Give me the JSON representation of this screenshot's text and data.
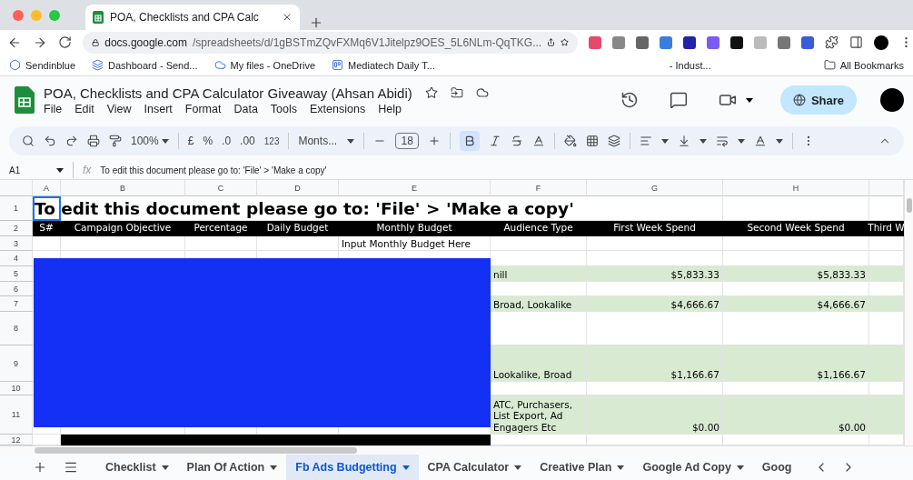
{
  "browser": {
    "tab_title": "POA, Checklists and CPA Calc",
    "url_host": "docs.google.com",
    "url_path": "/spreadsheets/d/1gBSTmZQvFXMq6V1Jitelpz9OES_5L6NLm-QqTKG...",
    "bookmarks": [
      "Sendinblue",
      "Dashboard - Send...",
      "My files - OneDrive",
      "Mediatech Daily T...",
      "- Indust..."
    ],
    "all_bookmarks": "All Bookmarks"
  },
  "doc": {
    "title": "POA, Checklists and CPA Calculator Giveaway (Ahsan Abidi)",
    "menu": [
      "File",
      "Edit",
      "View",
      "Insert",
      "Format",
      "Data",
      "Tools",
      "Extensions",
      "Help"
    ],
    "share": "Share"
  },
  "toolbar": {
    "zoom": "100%",
    "currency": "£",
    "percent": "%",
    "dec_less": ".0",
    "dec_more": ".00",
    "number_format": "123",
    "font": "Monts...",
    "font_size": "18",
    "bold_on": true
  },
  "formula_bar": {
    "cell": "A1",
    "fx": "fx",
    "value": "To edit this document please go to: 'File' > 'Make a copy'"
  },
  "columns": [
    "A",
    "B",
    "C",
    "D",
    "E",
    "F",
    "G",
    "H"
  ],
  "rows": [
    {
      "number": "1",
      "kind": "title",
      "title": "To edit this document please go to: 'File' > 'Make a copy'"
    },
    {
      "number": "2",
      "kind": "header",
      "headers": [
        "S#",
        "Campaign Objective",
        "Percentage",
        "Daily Budget",
        "Monthly Budget",
        "Audience Type",
        "First Week Spend",
        "Second Week Spend",
        "Third W"
      ]
    },
    {
      "number": "3",
      "kind": "data",
      "shaded": false,
      "monthly_budget": "Input Monthly Budget Here"
    },
    {
      "number": "4",
      "kind": "data",
      "shaded": false
    },
    {
      "number": "5",
      "kind": "data",
      "shaded": true,
      "audience_type": "nill",
      "first_week_spend": "$5,833.33",
      "second_week_spend": "$5,833.33"
    },
    {
      "number": "6",
      "kind": "data",
      "shaded": false
    },
    {
      "number": "7",
      "kind": "data",
      "shaded": true,
      "audience_type": "Broad, Lookalike",
      "first_week_spend": "$4,666.67",
      "second_week_spend": "$4,666.67"
    },
    {
      "number": "8",
      "kind": "data",
      "shaded": false
    },
    {
      "number": "9",
      "kind": "data",
      "shaded": true,
      "audience_type": "Lookalike, Broad",
      "first_week_spend": "$1,166.67",
      "second_week_spend": "$1,166.67"
    },
    {
      "number": "10",
      "kind": "data",
      "shaded": false
    },
    {
      "number": "11",
      "kind": "data",
      "shaded": true,
      "audience_type": "ATC, Purchasers, List Export, Ad Engagers Etc",
      "first_week_spend": "$0.00",
      "second_week_spend": "$0.00"
    },
    {
      "number": "12",
      "kind": "bar"
    }
  ],
  "sheets": [
    {
      "label": "Checklist",
      "selected": false
    },
    {
      "label": "Plan Of Action",
      "selected": false
    },
    {
      "label": "Fb Ads Budgetting",
      "selected": true
    },
    {
      "label": "CPA Calculator",
      "selected": false
    },
    {
      "label": "Creative Plan",
      "selected": false
    },
    {
      "label": "Google Ad Copy",
      "selected": false
    },
    {
      "label": "Goog",
      "selected": false
    }
  ]
}
